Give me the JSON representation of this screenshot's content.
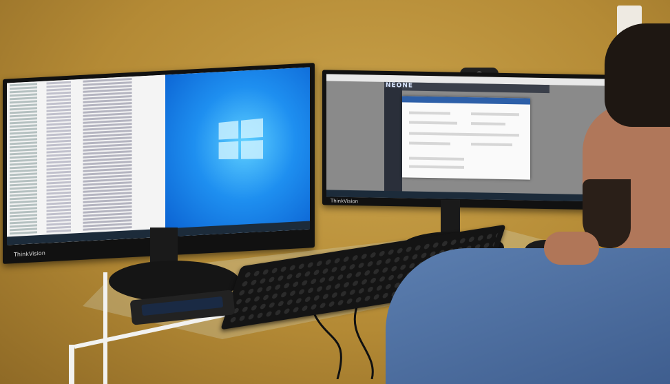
{
  "scene": {
    "description_visible_text": [],
    "left_monitor": {
      "brand": "ThinkVision"
    },
    "right_monitor": {
      "brand": "ThinkVision",
      "app_logo": "NEONE"
    }
  },
  "colors": {
    "wall": "#b48a35",
    "desktop_blue": "#1e8ff0",
    "shirt": "#4f6fa0"
  }
}
